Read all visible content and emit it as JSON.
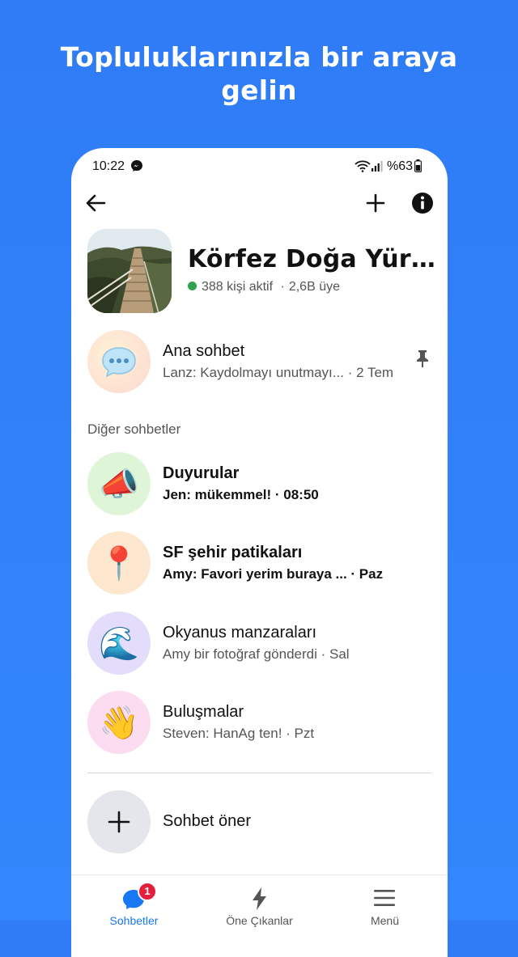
{
  "headline": {
    "line1": "Topluluklarınızla bir araya",
    "line2": "gelin"
  },
  "status_bar": {
    "time": "10:22",
    "battery": "%63"
  },
  "group": {
    "name": "Körfez Doğa Yürüyü...",
    "active": "388 kişi aktif",
    "separator": "·",
    "members": "2,6B üye"
  },
  "main_chat": {
    "title": "Ana sohbet",
    "preview": "Lanz: Kaydolmayı unutmayı...",
    "time": "· 2 Tem",
    "icon": "speech-bubble"
  },
  "section": {
    "label": "Diğer sohbetler"
  },
  "chats": [
    {
      "title": "Duyurular",
      "preview": "Jen: mükemmel! · 08:50",
      "icon": "megaphone",
      "emoji": "📣",
      "unread": true,
      "bg": "#dff5d8"
    },
    {
      "title": "SF şehir patikaları",
      "preview": "Amy: Favori yerim buraya ...  · Paz",
      "icon": "pushpin",
      "emoji": "📍",
      "unread": true,
      "bg": "#fde8cf"
    },
    {
      "title": "Okyanus manzaraları",
      "preview": "Amy bir fotoğraf gönderdi  · Sal",
      "icon": "wave",
      "emoji": "🌊",
      "unread": false,
      "bg": "#e3dcfa"
    },
    {
      "title": "Buluşmalar",
      "preview": "Steven: HanAg ten!  · Pzt",
      "icon": "waving-hand",
      "emoji": "👋",
      "unread": false,
      "bg": "#fbdcf0"
    }
  ],
  "suggest": {
    "label": "Sohbet öner"
  },
  "bottom_nav": {
    "items": [
      {
        "label": "Sohbetler",
        "icon": "chat-bubble",
        "badge": "1",
        "active": true
      },
      {
        "label": "Öne Çıkanlar",
        "icon": "lightning",
        "active": false
      },
      {
        "label": "Menü",
        "icon": "hamburger",
        "active": false
      }
    ]
  },
  "colors": {
    "background": "#3386fb",
    "accent": "#1877f2",
    "badge": "#e41e3f",
    "online": "#31a24c"
  }
}
